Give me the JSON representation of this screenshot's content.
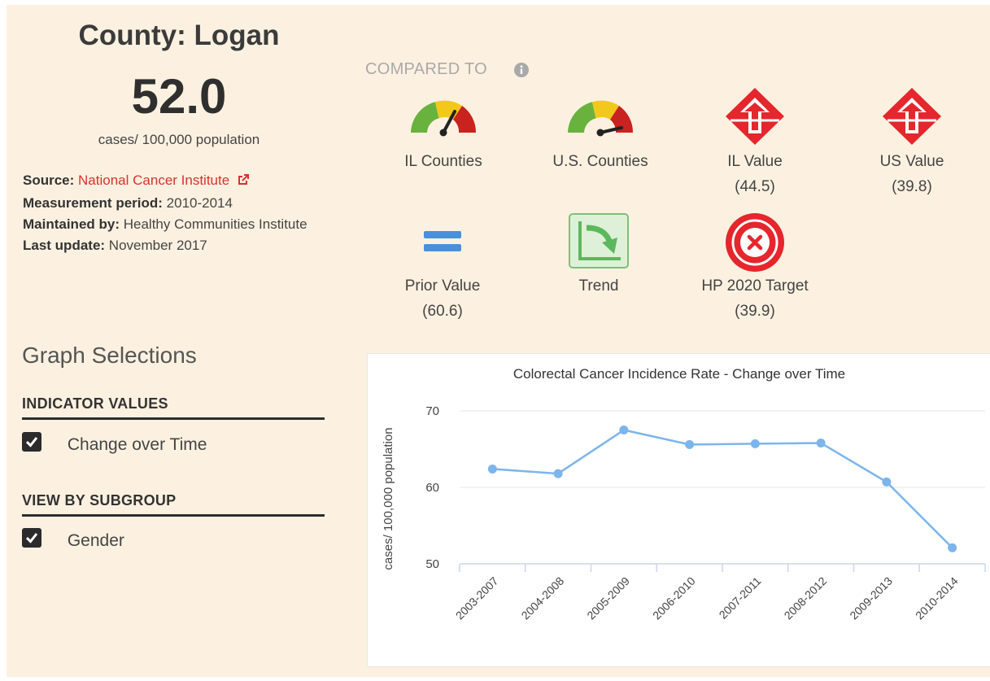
{
  "county": {
    "title": "County: Logan",
    "value": "52.0",
    "units": "cases/ 100,000 population"
  },
  "meta": {
    "source_label": "Source:",
    "source_link": "National Cancer Institute",
    "period_label": "Measurement period:",
    "period_value": "2010-2014",
    "maintained_label": "Maintained by:",
    "maintained_value": "Healthy Communities Institute",
    "update_label": "Last update:",
    "update_value": "November 2017"
  },
  "compared": {
    "heading": "COMPARED TO",
    "items": [
      {
        "label": "IL Counties",
        "value": "",
        "icon": "gauge-icon"
      },
      {
        "label": "U.S. Counties",
        "value": "",
        "icon": "gauge-icon"
      },
      {
        "label": "IL Value",
        "value": "(44.5)",
        "icon": "red-diamond-up-arrow-icon"
      },
      {
        "label": "US Value",
        "value": "(39.8)",
        "icon": "red-diamond-up-arrow-icon"
      },
      {
        "label": "Prior Value",
        "value": "(60.6)",
        "icon": "equals-icon"
      },
      {
        "label": "Trend",
        "value": "",
        "icon": "trend-down-icon"
      },
      {
        "label": "HP 2020 Target",
        "value": "(39.9)",
        "icon": "red-x-circle-icon"
      }
    ]
  },
  "graph_selections": {
    "title": "Graph Selections",
    "indicator_heading": "INDICATOR VALUES",
    "indicator_option": "Change over Time",
    "subgroup_heading": "VIEW BY SUBGROUP",
    "subgroup_option": "Gender"
  },
  "colors": {
    "accent_red": "#e5262c",
    "link_red": "#d9322b",
    "line_blue": "#7cb5ec",
    "trend_green": "#5cb85c",
    "equals_blue": "#4a90d9"
  },
  "chart_data": {
    "type": "line",
    "title": "Colorectal Cancer Incidence Rate - Change over Time",
    "xlabel": "",
    "ylabel": "cases/ 100,000 population",
    "categories": [
      "2003-2007",
      "2004-2008",
      "2005-2009",
      "2006-2010",
      "2007-2011",
      "2008-2012",
      "2009-2013",
      "2010-2014"
    ],
    "values": [
      62.4,
      61.8,
      67.5,
      65.6,
      65.7,
      65.8,
      60.7,
      52.1
    ],
    "ylim": [
      50,
      70
    ],
    "yticks": [
      50,
      60,
      70
    ],
    "grid": true
  }
}
